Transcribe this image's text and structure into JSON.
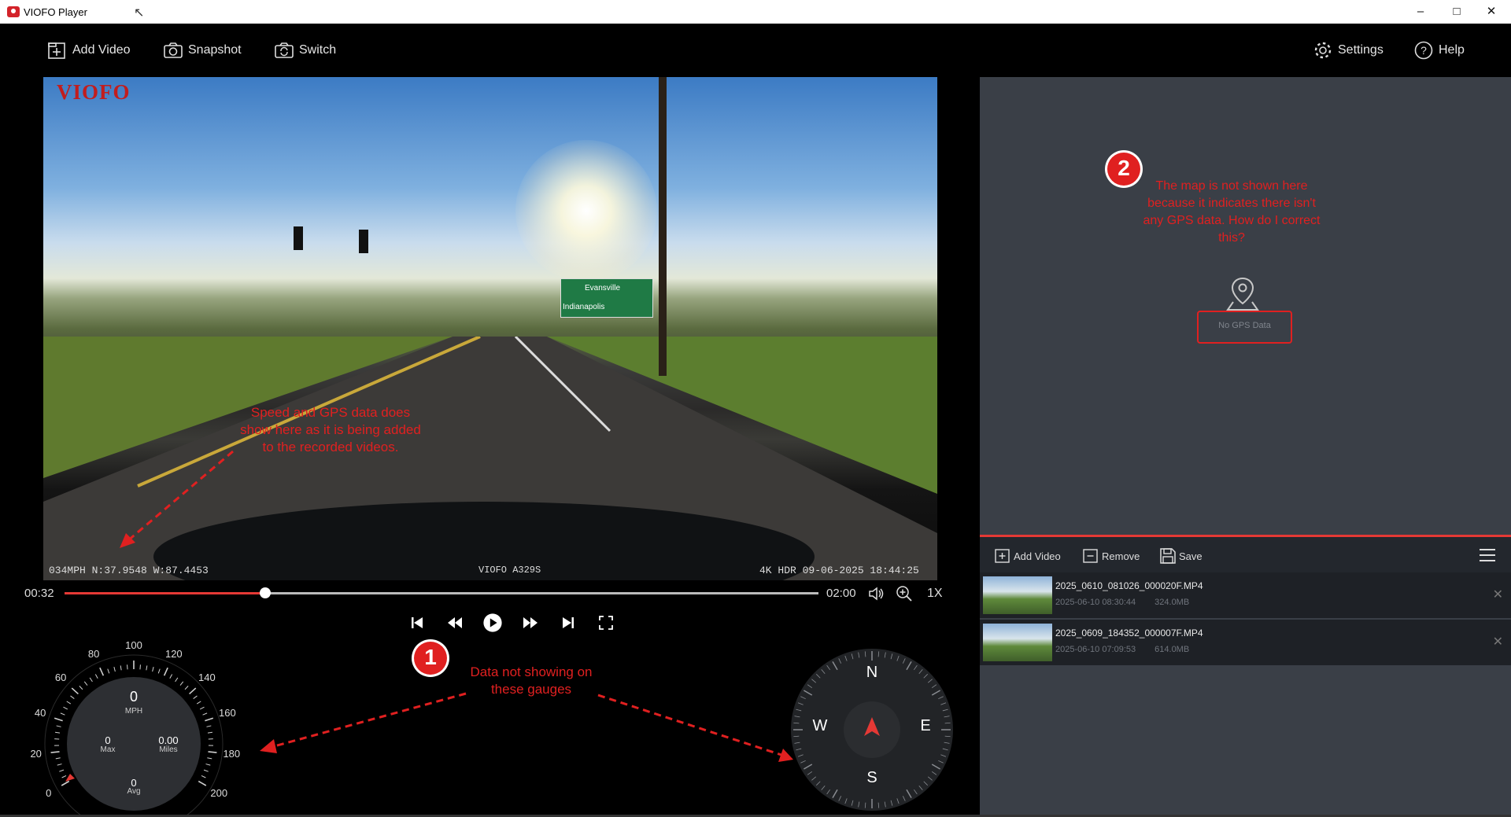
{
  "window": {
    "title": "VIOFO Player",
    "minimize": "–",
    "maximize": "□",
    "close": "✕"
  },
  "toolbar": {
    "add_video": "Add Video",
    "snapshot": "Snapshot",
    "switch": "Switch",
    "settings": "Settings",
    "help": "Help"
  },
  "video": {
    "watermark": "VIOFO",
    "osd_left": "034MPH  N:37.9548 W:87.4453",
    "osd_center": "VIOFO A329S",
    "osd_right": "4K HDR 09-06-2025 18:44:25",
    "road_signs": [
      "Evansville",
      "Indianapolis"
    ]
  },
  "annotations": {
    "note_video": [
      "Speed and GPS data does",
      "show here as it is being added",
      "to the recorded videos."
    ],
    "badge_1": "1",
    "note_gauges": [
      "Data not showing on",
      "these gauges"
    ],
    "badge_2": "2",
    "note_map": [
      "The map is not shown here",
      "because it indicates there isn't",
      "any GPS data.  How do I correct",
      "this?"
    ]
  },
  "playback": {
    "current_time": "00:32",
    "duration": "02:00",
    "progress": 0.2667,
    "speed": "1X"
  },
  "speedometer": {
    "ticks": [
      "0",
      "20",
      "40",
      "60",
      "80",
      "100",
      "120",
      "140",
      "160",
      "180",
      "200"
    ],
    "speed": "0",
    "unit": "MPH",
    "max_value": "0",
    "max_label": "Max",
    "miles_value": "0.00",
    "miles_label": "Miles",
    "avg_value": "0",
    "avg_label": "Avg"
  },
  "compass": {
    "n": "N",
    "e": "E",
    "s": "S",
    "w": "W"
  },
  "map": {
    "no_gps": "No GPS Data"
  },
  "playlist": {
    "add_video": "Add Video",
    "remove": "Remove",
    "save": "Save",
    "items": [
      {
        "name": "2025_0610_081026_000020F.MP4",
        "date": "2025-06-10 08:30:44",
        "size": "324.0MB"
      },
      {
        "name": "2025_0609_184352_000007F.MP4",
        "date": "2025-06-10 07:09:53",
        "size": "614.0MB"
      }
    ]
  },
  "colors": {
    "accent": "#e53935",
    "annotation": "#e02020",
    "panel": "#3a3f47"
  }
}
